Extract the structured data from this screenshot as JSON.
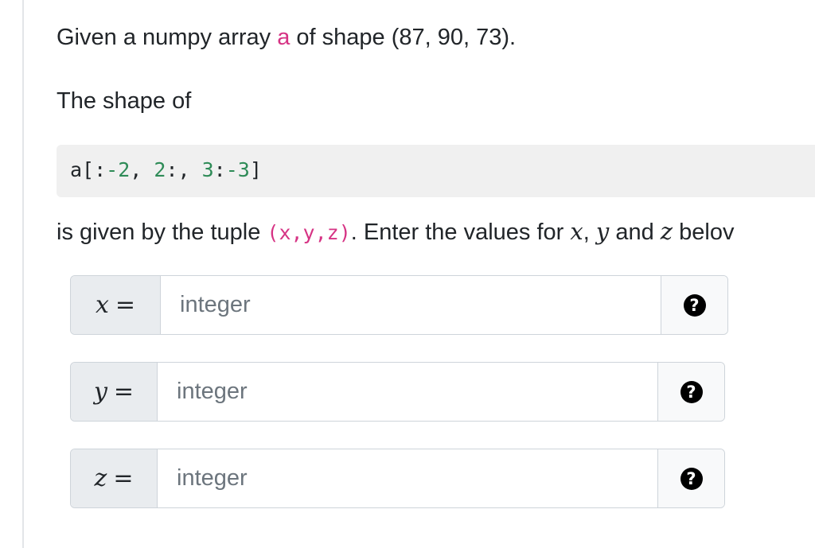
{
  "question": {
    "intro_prefix": "Given a numpy array ",
    "array_name": "a",
    "intro_suffix": " of shape (87, 90, 73).",
    "shape_of": "The shape of",
    "code": {
      "part1": "a[:",
      "n1": "-2",
      "part2": ", ",
      "n2": "2",
      "part3": ":, ",
      "n3": "3",
      "part4": ":",
      "n4": "-3",
      "part5": "]"
    },
    "tuple_prefix": "is given by the tuple ",
    "tuple": "(x,y,z)",
    "tuple_suffix": ". Enter the values for ",
    "var_x": "x",
    "sep1": ", ",
    "var_y": "y",
    "and": " and ",
    "var_z": "z",
    "below": " belov"
  },
  "inputs": [
    {
      "variable": "x",
      "equals": "=",
      "placeholder": "integer",
      "value": ""
    },
    {
      "variable": "y",
      "equals": "=",
      "placeholder": "integer",
      "value": ""
    },
    {
      "variable": "z",
      "equals": "=",
      "placeholder": "integer",
      "value": ""
    }
  ],
  "help_glyph": "?",
  "icons": {
    "help": "question-circle-icon"
  },
  "colors": {
    "inline_code": "#d63384",
    "code_number": "#2e8b57",
    "code_background": "#f0f0f0",
    "addon_background": "#e9ecef"
  }
}
